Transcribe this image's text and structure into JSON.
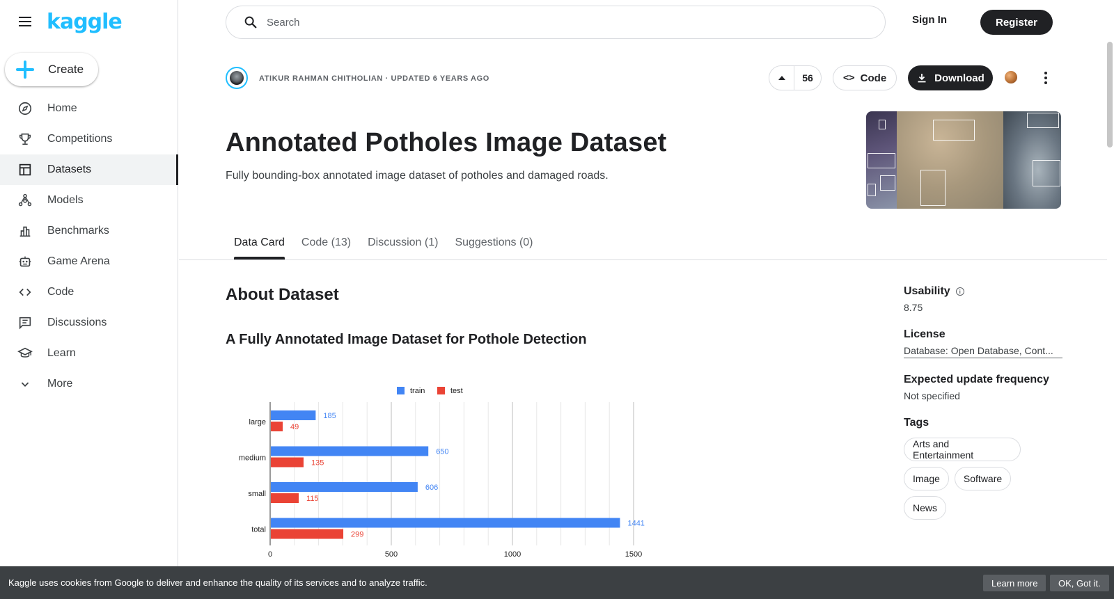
{
  "app": {
    "logo": "kaggle",
    "create_label": "Create"
  },
  "sidebar": {
    "items": [
      {
        "label": "Home",
        "icon": "compass-icon"
      },
      {
        "label": "Competitions",
        "icon": "trophy-icon"
      },
      {
        "label": "Datasets",
        "icon": "table-icon",
        "active": true
      },
      {
        "label": "Models",
        "icon": "models-icon"
      },
      {
        "label": "Benchmarks",
        "icon": "bar-chart-icon"
      },
      {
        "label": "Game Arena",
        "icon": "robot-icon"
      },
      {
        "label": "Code",
        "icon": "code-icon"
      },
      {
        "label": "Discussions",
        "icon": "comment-icon"
      },
      {
        "label": "Learn",
        "icon": "graduation-cap-icon"
      },
      {
        "label": "More",
        "icon": "chevron-down-icon"
      }
    ]
  },
  "topbar": {
    "search_placeholder": "Search",
    "signin_label": "Sign In",
    "register_label": "Register"
  },
  "header": {
    "owner_line": "ATIKUR RAHMAN CHITHOLIAN · UPDATED 6 YEARS AGO",
    "vote_count": "56",
    "code_label": "Code",
    "download_label": "Download",
    "title": "Annotated Potholes Image Dataset",
    "subtitle": "Fully bounding-box annotated image dataset of potholes and damaged roads."
  },
  "tabs": [
    {
      "label": "Data Card",
      "active": true
    },
    {
      "label": "Code (13)"
    },
    {
      "label": "Discussion (1)"
    },
    {
      "label": "Suggestions (0)"
    }
  ],
  "content": {
    "about_heading": "About Dataset",
    "section_heading": "A Fully Annotated Image Dataset for Pothole Detection"
  },
  "chart_data": {
    "type": "bar",
    "orientation": "horizontal",
    "categories": [
      "large",
      "medium",
      "small",
      "total"
    ],
    "series": [
      {
        "name": "train",
        "values": [
          185,
          650,
          606,
          1441
        ],
        "color": "#4285f4"
      },
      {
        "name": "test",
        "values": [
          49,
          135,
          115,
          299
        ],
        "color": "#ea4335"
      }
    ],
    "x_ticks": [
      "0",
      "500",
      "1000",
      "1500"
    ],
    "xlim": [
      0,
      1500
    ],
    "grid": true,
    "legend_position": "top"
  },
  "side": {
    "usability_label": "Usability",
    "usability_value": "8.75",
    "license_label": "License",
    "license_value": "Database: Open Database, Cont...",
    "frequency_label": "Expected update frequency",
    "frequency_value": "Not specified",
    "tags_label": "Tags",
    "tags": [
      "Arts and Entertainment",
      "Image",
      "Software",
      "News"
    ]
  },
  "cookie": {
    "message": "Kaggle uses cookies from Google to deliver and enhance the quality of its services and to analyze traffic.",
    "learn_more": "Learn more",
    "ok": "OK, Got it."
  }
}
